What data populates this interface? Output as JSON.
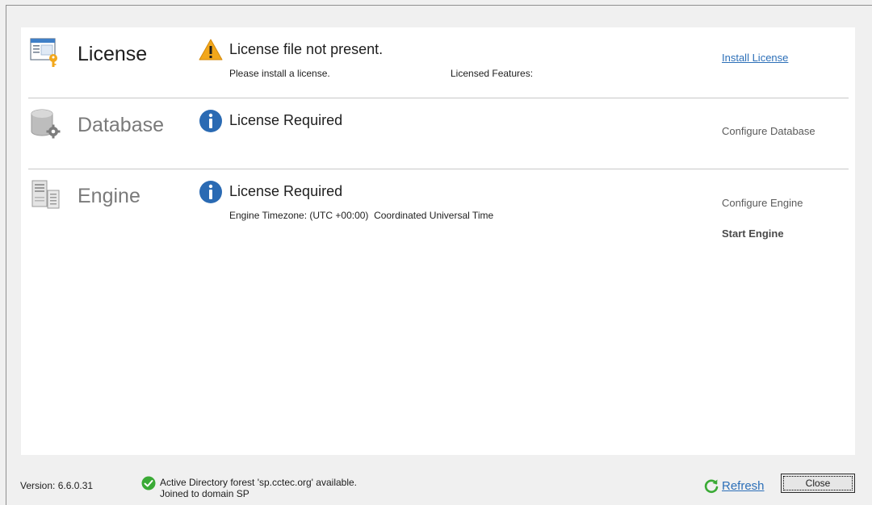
{
  "sections": {
    "license": {
      "title": "License",
      "status": "License file not present.",
      "detail": "Please install a license.",
      "features_label": "Licensed Features:",
      "action": "Install License"
    },
    "database": {
      "title": "Database",
      "status": "License Required",
      "action": "Configure Database"
    },
    "engine": {
      "title": "Engine",
      "status": "License Required",
      "timezone": "Engine Timezone: (UTC +00:00)  Coordinated Universal Time",
      "action_configure": "Configure Engine",
      "action_start": "Start Engine"
    }
  },
  "footer": {
    "version": "Version: 6.6.0.31",
    "ad_line1": "Active Directory forest 'sp.cctec.org' available.",
    "ad_line2": "Joined to domain SP",
    "refresh_label": "Refresh",
    "close_label": "Close"
  },
  "colors": {
    "link": "#2c6fb8",
    "warning": "#f2a71b",
    "info": "#2a6ab3",
    "success": "#3aaa35"
  },
  "icons": {
    "license": "license-certificate-icon",
    "database": "database-gear-icon",
    "engine": "server-icon",
    "warning": "warning-icon",
    "info": "info-icon",
    "success": "check-circle-icon",
    "refresh": "refresh-icon"
  }
}
